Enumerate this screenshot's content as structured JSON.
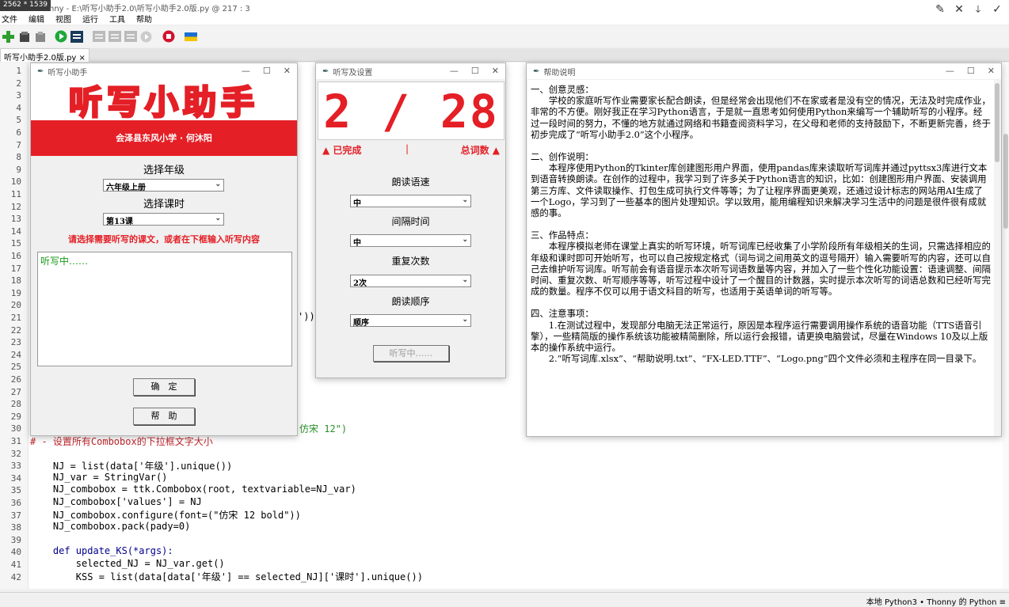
{
  "window": {
    "resolution_badge": "2562 * 1539",
    "title": "nny - E:\\听写小助手2.0\\听写小助手2.0版.py @ 217 : 3"
  },
  "menu": [
    "文件",
    "编辑",
    "视图",
    "运行",
    "工具",
    "帮助"
  ],
  "tab": {
    "label": "听写小助手2.0版.py",
    "close": "×"
  },
  "editor": {
    "line_numbers": [
      "1",
      "2",
      "3",
      "4",
      "5",
      "6",
      "7",
      "8",
      "9",
      "10",
      "11",
      "12",
      "13",
      "14",
      "15",
      "16",
      "17",
      "18",
      "19",
      "20",
      "21",
      "22",
      "23",
      "24",
      "25",
      "26",
      "27",
      "28",
      "29",
      "30",
      "31",
      "32",
      "33",
      "34",
      "35",
      "36",
      "37",
      "38",
      "39",
      "40",
      "41",
      "42"
    ],
    "partial_line_21": "'))",
    "partial_line_30": "仿宋 12\")",
    "comment_line_31": "# - 设置所有Combobox的下拉框文字大小",
    "lines": {
      "l33": "    NJ = list(data['年级'].unique())",
      "l34": "    NJ_var = StringVar()",
      "l35": "    NJ_combobox = ttk.Combobox(root, textvariable=NJ_var)",
      "l36": "    NJ_combobox['values'] = NJ",
      "l37": "    NJ_combobox.configure(font=(\"仿宋 12 bold\"))",
      "l38": "    NJ_combobox.pack(pady=0)",
      "l40": "    def update_KS(*args):",
      "l41": "        selected_NJ = NJ_var.get()",
      "l42": "        KSS = list(data[data['年级'] == selected_NJ]['课时'].unique())"
    }
  },
  "status": {
    "text": "本地 Python3 • Thonny 的 Python ≡"
  },
  "win_main": {
    "title": "听写小助手",
    "banner_title": "听写小助手",
    "banner_sub": "会泽县东风小学 · 何沐阳",
    "grade_label": "选择年级",
    "grade_value": "六年级上册",
    "lesson_label": "选择课时",
    "lesson_value": "第13课",
    "hint": "请选择需要听写的课文，或者在下框输入听写内容",
    "textbox": "听写中……",
    "ok_button": "确　定",
    "help_button": "帮　助"
  },
  "win_settings": {
    "title": "听写及设置",
    "led": "2 / 28",
    "done_label": "▲ 已完成",
    "sep": "|",
    "total_label": "总词数 ▲",
    "speed_label": "朗读语速",
    "speed_value": "中",
    "interval_label": "间隔时间",
    "interval_value": "中",
    "repeat_label": "重复次数",
    "repeat_value": "2次",
    "order_label": "朗读顺序",
    "order_value": "顺序",
    "status_button": "听写中……"
  },
  "win_help": {
    "title": "帮助说明",
    "p1_head": "一、创意灵感：",
    "p1": "　　学校的家庭听写作业需要家长配合朗读，但是经常会出现他们不在家或者是没有空的情况，无法及时完成作业，非常的不方便。刚好我正在学习Python语言，于是就一直思考如何使用Python来编写一个辅助听写的小程序。经过一段时间的努力，不懂的地方就通过网络和书籍查阅资料学习，在父母和老师的支持鼓励下，不断更新完善，终于初步完成了“听写小助手2.0”这个小程序。",
    "p2_head": "二、创作说明：",
    "p2": "　　本程序使用Python的Tkinter库创建图形用户界面，使用pandas库来读取听写词库并通过pyttsx3库进行文本到语音转换朗读。在创作的过程中，我学习到了许多关于Python语言的知识，比如：创建图形用户界面、安装调用第三方库、文件读取操作、打包生成可执行文件等等；为了让程序界面更美观，还通过设计标志的网站用AI生成了一个Logo，学习到了一些基本的图片处理知识。学以致用，能用编程知识来解决学习生活中的问题是很件很有成就感的事。",
    "p3_head": "三、作品特点：",
    "p3": "　　本程序模拟老师在课堂上真实的听写环境，听写词库已经收集了小学阶段所有年级相关的生词，只需选择相应的年级和课时即可开始听写，也可以自己按规定格式（词与词之间用英文的逗号隔开）输入需要听写的内容，还可以自己去维护听写词库。听写前会有语音提示本次听写词语数量等内容，并加入了一些个性化功能设置：语速调整、间隔时间、重复次数、听写顺序等等，听写过程中设计了一个醒目的计数器，实时提示本次听写的词语总数和已经听写完成的数量。程序不仅可以用于语文科目的听写，也适用于英语单词的听写等。",
    "p4_head": "四、注意事项：",
    "p4a": "　　1.在测试过程中，发现部分电脑无法正常运行，原因是本程序运行需要调用操作系统的语音功能（TTS语音引擎），一些精简版的操作系统该功能被精简删除，所以运行会报错，请更换电脑尝试，尽量在Windows 10及以上版本的操作系统中运行。",
    "p4b": "　　2.“听写词库.xlsx”、“帮助说明.txt”、“FX-LED.TTF”、“Logo.png”四个文件必须和主程序在同一目录下。"
  }
}
